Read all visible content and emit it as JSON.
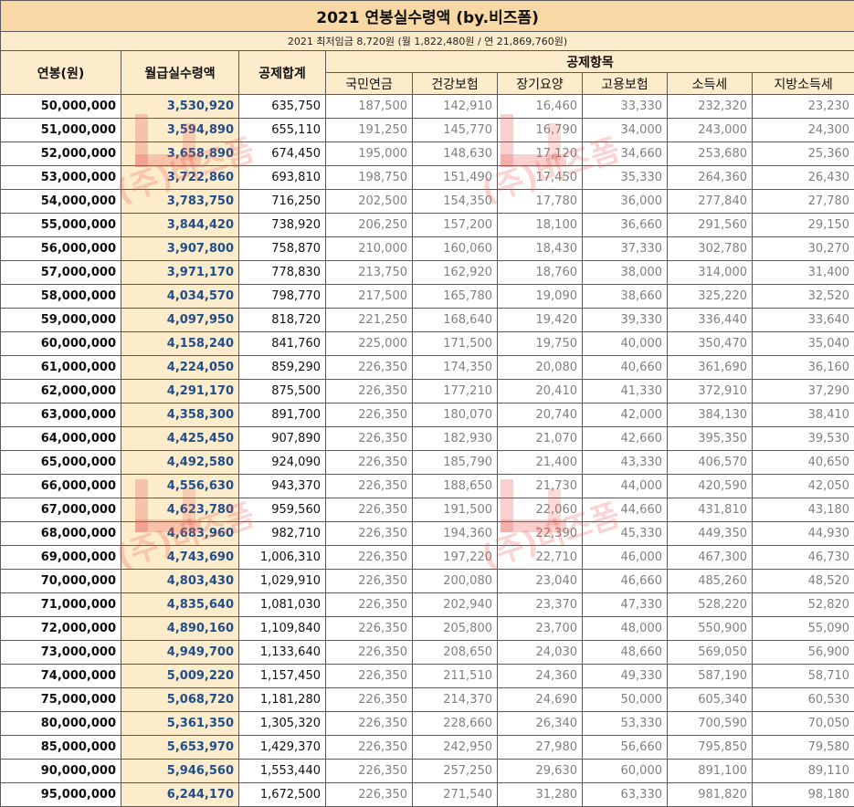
{
  "title": "2021 연봉실수령액 (by.비즈폼)",
  "subtitle": "2021 최저임금 8,720원 (월 1,822,480원 / 연 21,869,760원)",
  "headers": {
    "salary": "연봉(원)",
    "net": "월급실수령액",
    "total": "공제합계",
    "items_group": "공제항목",
    "items": [
      "국민연금",
      "건강보험",
      "장기요양",
      "고용보험",
      "소득세",
      "지방소득세"
    ]
  },
  "watermark": {
    "text": "(주)비즈폼"
  },
  "rows": [
    [
      "50,000,000",
      "3,530,920",
      "635,750",
      "187,500",
      "142,910",
      "16,460",
      "33,330",
      "232,320",
      "23,230"
    ],
    [
      "51,000,000",
      "3,594,890",
      "655,110",
      "191,250",
      "145,770",
      "16,790",
      "34,000",
      "243,000",
      "24,300"
    ],
    [
      "52,000,000",
      "3,658,890",
      "674,450",
      "195,000",
      "148,630",
      "17,120",
      "34,660",
      "253,680",
      "25,360"
    ],
    [
      "53,000,000",
      "3,722,860",
      "693,810",
      "198,750",
      "151,490",
      "17,450",
      "35,330",
      "264,360",
      "26,430"
    ],
    [
      "54,000,000",
      "3,783,750",
      "716,250",
      "202,500",
      "154,350",
      "17,780",
      "36,000",
      "277,840",
      "27,780"
    ],
    [
      "55,000,000",
      "3,844,420",
      "738,920",
      "206,250",
      "157,200",
      "18,100",
      "36,660",
      "291,560",
      "29,150"
    ],
    [
      "56,000,000",
      "3,907,800",
      "758,870",
      "210,000",
      "160,060",
      "18,430",
      "37,330",
      "302,780",
      "30,270"
    ],
    [
      "57,000,000",
      "3,971,170",
      "778,830",
      "213,750",
      "162,920",
      "18,760",
      "38,000",
      "314,000",
      "31,400"
    ],
    [
      "58,000,000",
      "4,034,570",
      "798,770",
      "217,500",
      "165,780",
      "19,090",
      "38,660",
      "325,220",
      "32,520"
    ],
    [
      "59,000,000",
      "4,097,950",
      "818,720",
      "221,250",
      "168,640",
      "19,420",
      "39,330",
      "336,440",
      "33,640"
    ],
    [
      "60,000,000",
      "4,158,240",
      "841,760",
      "225,000",
      "171,500",
      "19,750",
      "40,000",
      "350,470",
      "35,040"
    ],
    [
      "61,000,000",
      "4,224,050",
      "859,290",
      "226,350",
      "174,350",
      "20,080",
      "40,660",
      "361,690",
      "36,160"
    ],
    [
      "62,000,000",
      "4,291,170",
      "875,500",
      "226,350",
      "177,210",
      "20,410",
      "41,330",
      "372,910",
      "37,290"
    ],
    [
      "63,000,000",
      "4,358,300",
      "891,700",
      "226,350",
      "180,070",
      "20,740",
      "42,000",
      "384,130",
      "38,410"
    ],
    [
      "64,000,000",
      "4,425,450",
      "907,890",
      "226,350",
      "182,930",
      "21,070",
      "42,660",
      "395,350",
      "39,530"
    ],
    [
      "65,000,000",
      "4,492,580",
      "924,090",
      "226,350",
      "185,790",
      "21,400",
      "43,330",
      "406,570",
      "40,650"
    ],
    [
      "66,000,000",
      "4,556,630",
      "943,370",
      "226,350",
      "188,650",
      "21,730",
      "44,000",
      "420,590",
      "42,050"
    ],
    [
      "67,000,000",
      "4,623,780",
      "959,560",
      "226,350",
      "191,500",
      "22,060",
      "44,660",
      "431,810",
      "43,180"
    ],
    [
      "68,000,000",
      "4,683,960",
      "982,710",
      "226,350",
      "194,360",
      "22,390",
      "45,330",
      "449,350",
      "44,930"
    ],
    [
      "69,000,000",
      "4,743,690",
      "1,006,310",
      "226,350",
      "197,220",
      "22,710",
      "46,000",
      "467,300",
      "46,730"
    ],
    [
      "70,000,000",
      "4,803,430",
      "1,029,910",
      "226,350",
      "200,080",
      "23,040",
      "46,660",
      "485,260",
      "48,520"
    ],
    [
      "71,000,000",
      "4,835,640",
      "1,081,030",
      "226,350",
      "202,940",
      "23,370",
      "47,330",
      "528,220",
      "52,820"
    ],
    [
      "72,000,000",
      "4,890,160",
      "1,109,840",
      "226,350",
      "205,800",
      "23,700",
      "48,000",
      "550,900",
      "55,090"
    ],
    [
      "73,000,000",
      "4,949,700",
      "1,133,640",
      "226,350",
      "208,650",
      "24,030",
      "48,660",
      "569,050",
      "56,900"
    ],
    [
      "74,000,000",
      "5,009,220",
      "1,157,450",
      "226,350",
      "211,510",
      "24,360",
      "49,330",
      "587,190",
      "58,710"
    ],
    [
      "75,000,000",
      "5,068,720",
      "1,181,280",
      "226,350",
      "214,370",
      "24,690",
      "50,000",
      "605,340",
      "60,530"
    ],
    [
      "80,000,000",
      "5,361,350",
      "1,305,320",
      "226,350",
      "228,660",
      "26,340",
      "53,330",
      "700,590",
      "70,050"
    ],
    [
      "85,000,000",
      "5,653,970",
      "1,429,370",
      "226,350",
      "242,950",
      "27,980",
      "56,660",
      "795,850",
      "79,580"
    ],
    [
      "90,000,000",
      "5,946,560",
      "1,553,440",
      "226,350",
      "257,250",
      "29,630",
      "60,000",
      "891,100",
      "89,110"
    ],
    [
      "95,000,000",
      "6,244,170",
      "1,672,500",
      "226,350",
      "271,540",
      "31,280",
      "63,330",
      "981,820",
      "98,180"
    ]
  ]
}
